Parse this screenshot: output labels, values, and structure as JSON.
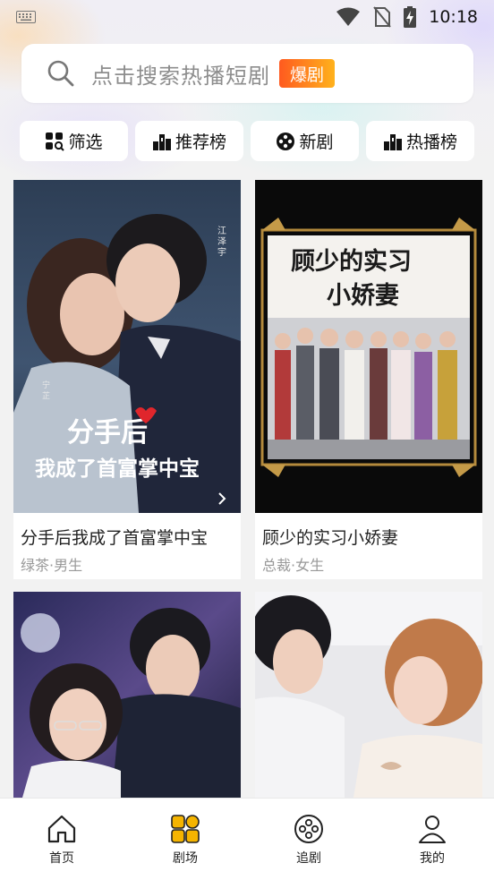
{
  "status_bar": {
    "time": "10:18"
  },
  "search": {
    "placeholder": "点击搜索热播短剧",
    "badge": "爆剧"
  },
  "filters": [
    {
      "label": "筛选",
      "icon": "filter-grid-icon"
    },
    {
      "label": "推荐榜",
      "icon": "rank-bars-icon"
    },
    {
      "label": "新剧",
      "icon": "film-reel-icon"
    },
    {
      "label": "热播榜",
      "icon": "rank-bars-icon"
    }
  ],
  "dramas": [
    {
      "title": "分手后我成了首富掌中宝",
      "tags": "绿茶·男生",
      "poster_text": "分手后我成了首富掌中宝"
    },
    {
      "title": "顾少的实习小娇妻",
      "tags": "总裁·女生",
      "poster_text": "顾少的实习小娇妻"
    },
    {
      "title": "",
      "tags": ""
    },
    {
      "title": "",
      "tags": ""
    }
  ],
  "tabbar": [
    {
      "label": "首页",
      "icon": "home-icon"
    },
    {
      "label": "剧场",
      "icon": "theater-grid-icon",
      "active": true
    },
    {
      "label": "追剧",
      "icon": "film-reel-icon"
    },
    {
      "label": "我的",
      "icon": "user-icon"
    }
  ],
  "colors": {
    "accent": "#f5b400",
    "badge_start": "#ff5a1f",
    "badge_end": "#ffb21c"
  }
}
